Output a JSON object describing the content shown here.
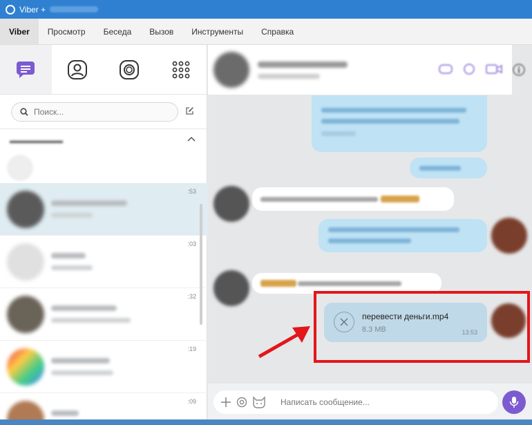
{
  "window": {
    "title": "Viber +"
  },
  "menu": {
    "items": [
      "Viber",
      "Просмотр",
      "Беседа",
      "Вызов",
      "Инструменты",
      "Справка"
    ]
  },
  "sidebar": {
    "search_placeholder": "Поиск...",
    "chats": [
      {
        "time": ":53",
        "avatar_color": "#5a5a5a"
      },
      {
        "time": ":03",
        "avatar_color": "#e0e0e0"
      },
      {
        "time": ":32",
        "avatar_color": "#6a6358"
      },
      {
        "time": ":19",
        "avatar_color": "#d98a8a"
      },
      {
        "time": ":09",
        "avatar_color": "#b07a55"
      }
    ]
  },
  "conversation": {
    "file_message": {
      "file_name": "перевести деньги.mp4",
      "file_size": "8.3 MB",
      "time": "13:53"
    }
  },
  "composer": {
    "placeholder": "Написать сообщение..."
  },
  "colors": {
    "accent": "#7c5bd0",
    "titlebar": "#2f80d1",
    "highlight": "#e3161b",
    "outgoing_bubble": "#bfe2f5"
  }
}
